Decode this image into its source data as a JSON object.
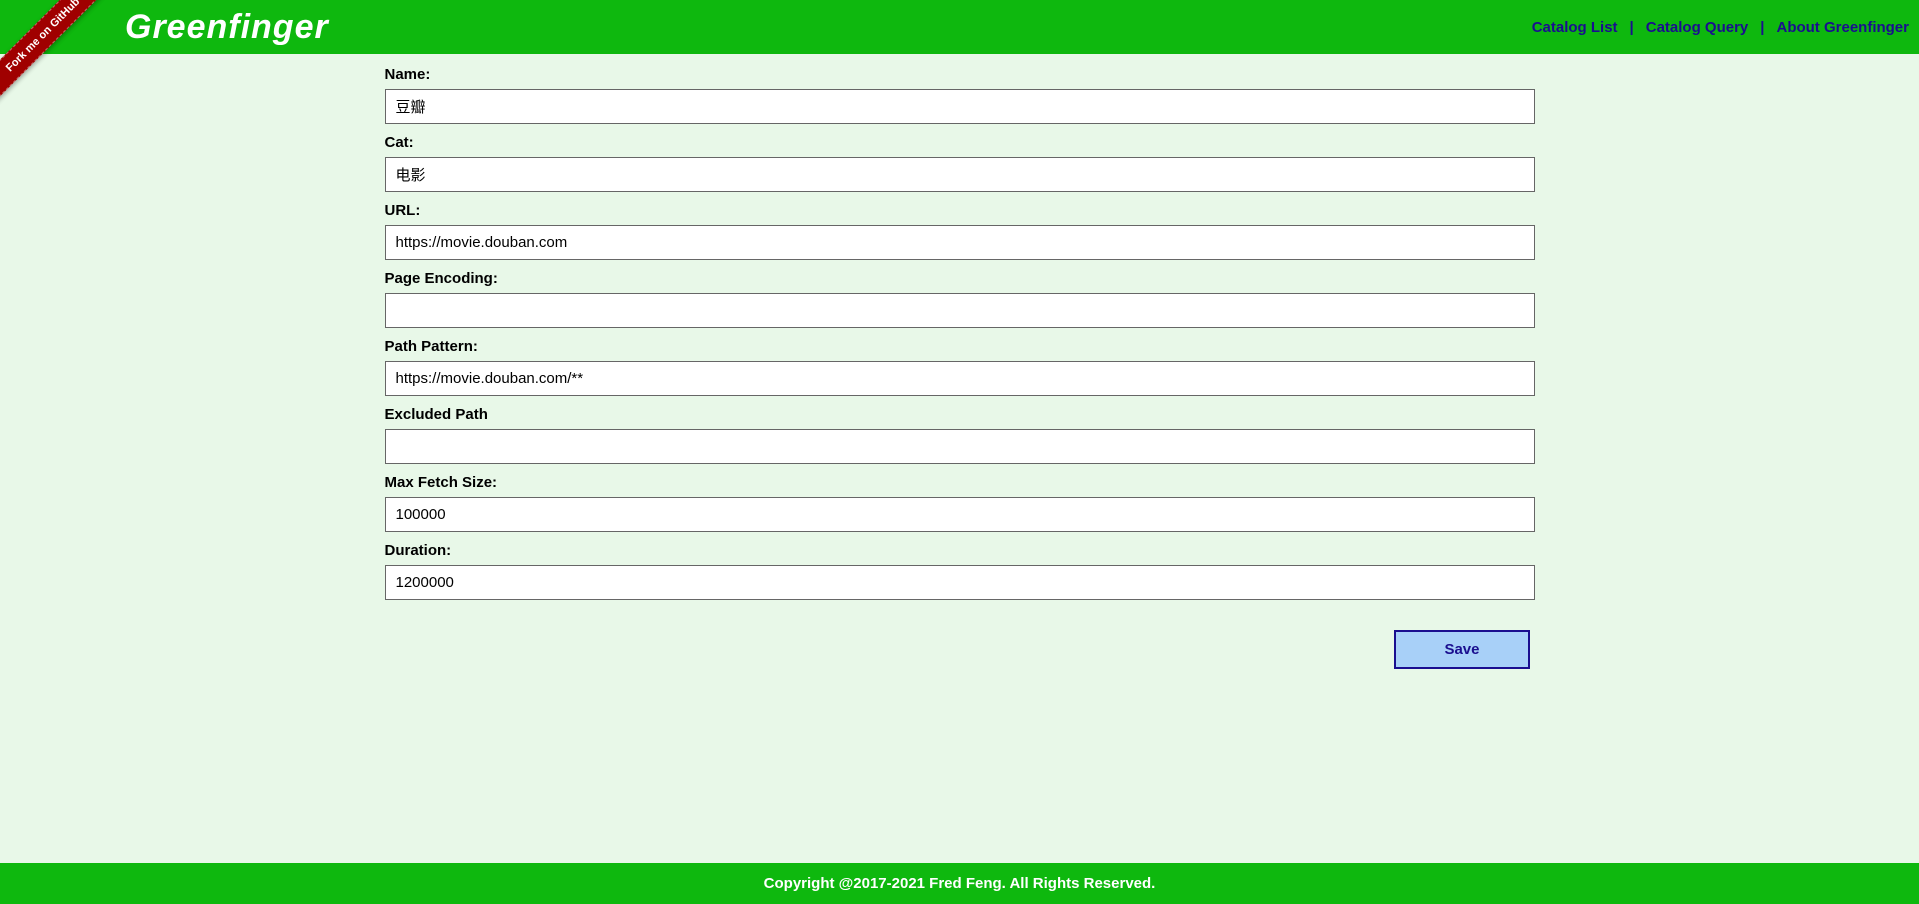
{
  "header": {
    "logo": "Greenfinger",
    "github_ribbon": "Fork me on GitHub",
    "nav": {
      "catalog_list": "Catalog List",
      "catalog_query": "Catalog Query",
      "about": "About Greenfinger"
    }
  },
  "form": {
    "name": {
      "label": "Name:",
      "value": "豆瓣"
    },
    "cat": {
      "label": "Cat:",
      "value": "电影"
    },
    "url": {
      "label": "URL:",
      "value": "https://movie.douban.com"
    },
    "page_encoding": {
      "label": "Page Encoding:",
      "value": ""
    },
    "path_pattern": {
      "label": "Path Pattern:",
      "value": "https://movie.douban.com/**"
    },
    "excluded_path": {
      "label": "Excluded Path",
      "value": ""
    },
    "max_fetch_size": {
      "label": "Max Fetch Size:",
      "value": "100000"
    },
    "duration": {
      "label": "Duration:",
      "value": "1200000"
    },
    "save_button": "Save"
  },
  "footer": {
    "copyright": "Copyright @2017-2021 Fred Feng. All Rights Reserved."
  }
}
